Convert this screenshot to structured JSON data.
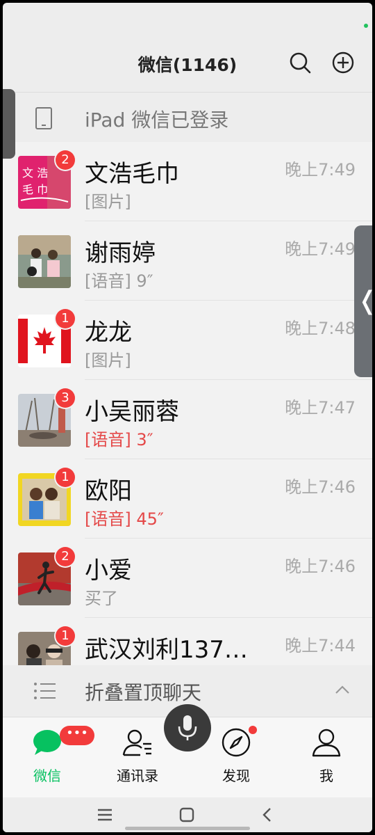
{
  "header": {
    "title": "微信(1146)"
  },
  "ipad_notice": "iPad 微信已登录",
  "chats": [
    {
      "name": "文浩毛巾",
      "message": "[图片]",
      "time": "晚上7:49",
      "badge": "2",
      "msg_red": false,
      "avatar_text": "文浩毛巾"
    },
    {
      "name": "谢雨婷",
      "message": "[语音] 9″",
      "time": "晚上7:49",
      "badge": "",
      "msg_red": false
    },
    {
      "name": "龙龙",
      "message": "[图片]",
      "time": "晚上7:48",
      "badge": "1",
      "msg_red": false
    },
    {
      "name": "小吴丽蓉",
      "message": "[语音] 3″",
      "time": "晚上7:47",
      "badge": "3",
      "msg_red": true
    },
    {
      "name": "欧阳",
      "message": "[语音] 45″",
      "time": "晚上7:46",
      "badge": "1",
      "msg_red": true
    },
    {
      "name": "小爱",
      "message": "买了",
      "time": "晚上7:46",
      "badge": "2",
      "msg_red": false
    },
    {
      "name": "武汉刘利137…",
      "message": "",
      "time": "晚上7:44",
      "badge": "1",
      "msg_red": false
    }
  ],
  "folded": {
    "label": "折叠置顶聊天"
  },
  "tabs": {
    "chats": "微信",
    "contacts": "通讯录",
    "discover": "发现",
    "me": "我",
    "chats_badge": "•••"
  },
  "colors": {
    "accent": "#07c160",
    "badge": "#f23b3b",
    "background": "#ededed"
  }
}
